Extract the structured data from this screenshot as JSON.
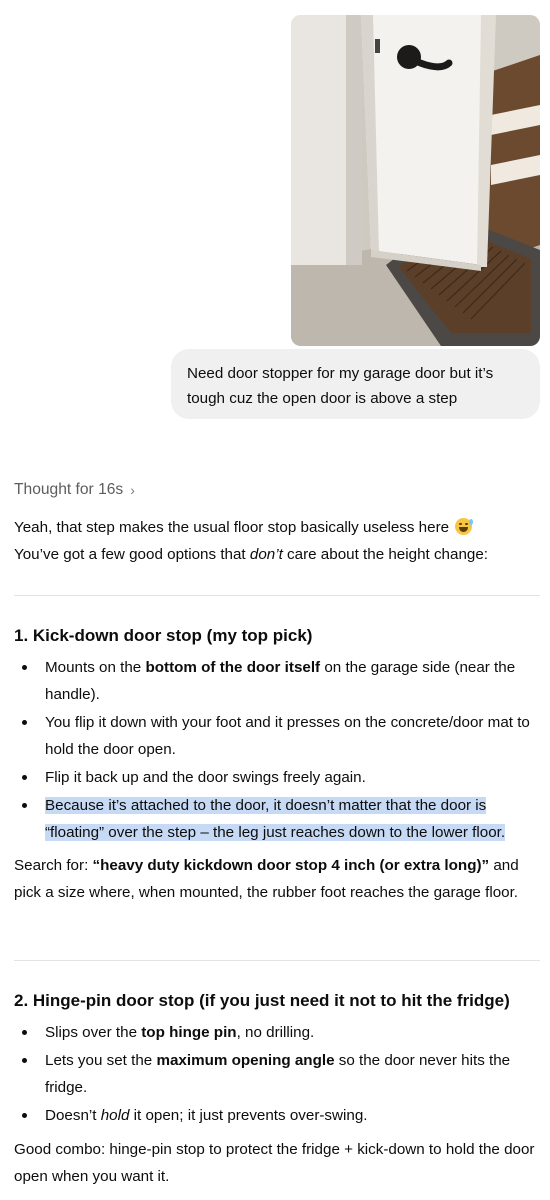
{
  "user_message": {
    "line1": "Need door stopper for my garage door but it’s",
    "line2": "tough cuz the open door is above a step"
  },
  "thought": {
    "label": "Thought for 16s",
    "chevron": "›"
  },
  "intro": {
    "line1": "Yeah, that step makes the usual floor stop basically useless here",
    "line2_pre": "You’ve got a few good options that ",
    "line2_em": "don’t",
    "line2_post": " care about the height change:"
  },
  "section1": {
    "heading": "1. Kick-down door stop (my top pick)",
    "bullets": [
      {
        "pre": "Mounts on the ",
        "bold": "bottom of the door itself",
        "post": " on the garage side (near the handle)."
      },
      {
        "text": "You flip it down with your foot and it presses on the concrete/door mat to hold the door open."
      },
      {
        "text": "Flip it back up and the door swings freely again."
      },
      {
        "text": "Because it’s attached to the door, it doesn’t matter that the door is “floating” over the step – the leg just reaches down to the lower floor."
      }
    ],
    "search_pre": "Search for: ",
    "search_bold": "“heavy duty kickdown door stop 4 inch (or extra long)”",
    "search_post": " and pick a size where, when mounted, the rubber foot reaches the garage floor."
  },
  "section2": {
    "heading": "2. Hinge-pin door stop (if you just need it not to hit the fridge)",
    "bullets": [
      {
        "pre": "Slips over the ",
        "bold": "top hinge pin",
        "post": ", no drilling."
      },
      {
        "pre": "Lets you set the ",
        "bold": "maximum opening angle",
        "post": " so the door never hits the fridge."
      },
      {
        "pre": "Doesn’t ",
        "em": "hold",
        "post": " it open; it just prevents over-swing."
      }
    ],
    "combo": "Good combo: hinge-pin stop to protect the fridge + kick-down to hold the door open when you want it."
  },
  "colors": {
    "bubble_bg": "#f0f0f0",
    "highlight": "#c7daf5",
    "muted_text": "#5d5d5d",
    "divider": "#e3e3e3"
  }
}
